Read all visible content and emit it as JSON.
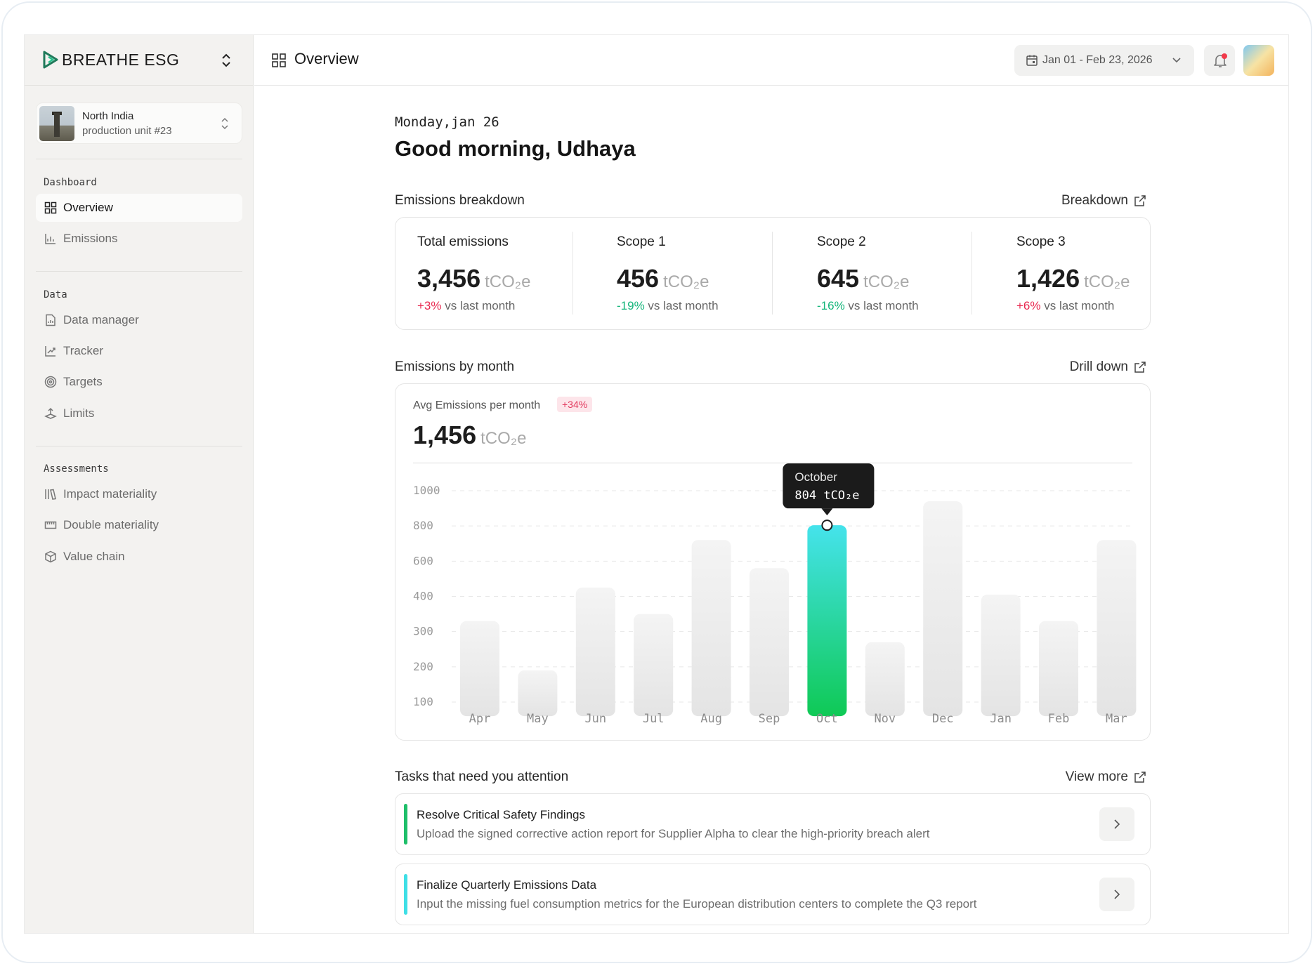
{
  "brand": {
    "name": "BREATHE ESG"
  },
  "unit": {
    "name": "North India",
    "subtitle": "production unit #23"
  },
  "sidebar": {
    "sections": [
      {
        "label": "Dashboard",
        "items": [
          {
            "label": "Overview",
            "icon": "grid-icon",
            "active": true
          },
          {
            "label": "Emissions",
            "icon": "chart-icon"
          }
        ]
      },
      {
        "label": "Data",
        "items": [
          {
            "label": "Data manager",
            "icon": "file-chart-icon"
          },
          {
            "label": "Tracker",
            "icon": "tracker-icon"
          },
          {
            "label": "Targets",
            "icon": "target-icon"
          },
          {
            "label": "Limits",
            "icon": "limits-icon"
          }
        ]
      },
      {
        "label": "Assessments",
        "items": [
          {
            "label": "Impact materiality",
            "icon": "books-icon"
          },
          {
            "label": "Double materiality",
            "icon": "ruler-icon"
          },
          {
            "label": "Value chain",
            "icon": "box-icon"
          }
        ]
      }
    ]
  },
  "topbar": {
    "title": "Overview",
    "date_range": "Jan 01 - Feb 23, 2026"
  },
  "main": {
    "date": "Monday,jan 26",
    "greeting": "Good morning, Udhaya",
    "breakdown": {
      "title": "Emissions breakdown",
      "link": "Breakdown",
      "unit": "tCO₂e",
      "stats": [
        {
          "label": "Total emissions",
          "value": "3,456",
          "change": "+3%",
          "change_suffix": " vs last month",
          "direction": "up"
        },
        {
          "label": "Scope 1",
          "value": "456",
          "change": "-19%",
          "change_suffix": " vs last month",
          "direction": "down"
        },
        {
          "label": "Scope 2",
          "value": "645",
          "change": "-16%",
          "change_suffix": " vs last month",
          "direction": "down"
        },
        {
          "label": "Scope 3",
          "value": "1,426",
          "change": "+6%",
          "change_suffix": " vs last month",
          "direction": "up"
        }
      ]
    },
    "by_month": {
      "title": "Emissions by month",
      "link": "Drill down",
      "avg_label": "Avg Emissions per month",
      "avg_badge": "+34%",
      "avg_value": "1,456",
      "unit": "tCO₂e"
    },
    "tasks": {
      "title": "Tasks that need you attention",
      "link": "View more",
      "items": [
        {
          "title": "Resolve Critical Safety Findings",
          "description": "Upload the signed corrective action report for Supplier Alpha to clear the high-priority breach alert",
          "accent": "#1fbf6a"
        },
        {
          "title": "Finalize Quarterly Emissions Data",
          "description": "Input the missing fuel consumption metrics for the European distribution centers to complete the Q3 report",
          "accent": "#3fdfe6"
        }
      ]
    }
  },
  "chart_data": {
    "type": "bar",
    "categories": [
      "Apr",
      "May",
      "Jun",
      "Jul",
      "Aug",
      "Sep",
      "Oct",
      "Nov",
      "Dec",
      "Jan",
      "Feb",
      "Mar"
    ],
    "values": [
      330,
      190,
      450,
      350,
      720,
      560,
      804,
      270,
      940,
      410,
      330,
      720
    ],
    "y_ticks": [
      100,
      200,
      300,
      400,
      600,
      800,
      1000
    ],
    "highlight_index": 6,
    "tooltip": {
      "title": "October",
      "value": "804 tCO₂e"
    },
    "grid": true,
    "colors": {
      "bar": "#ebebeb",
      "highlight_top": "#45e3ec",
      "highlight_bottom": "#0fc955"
    }
  }
}
